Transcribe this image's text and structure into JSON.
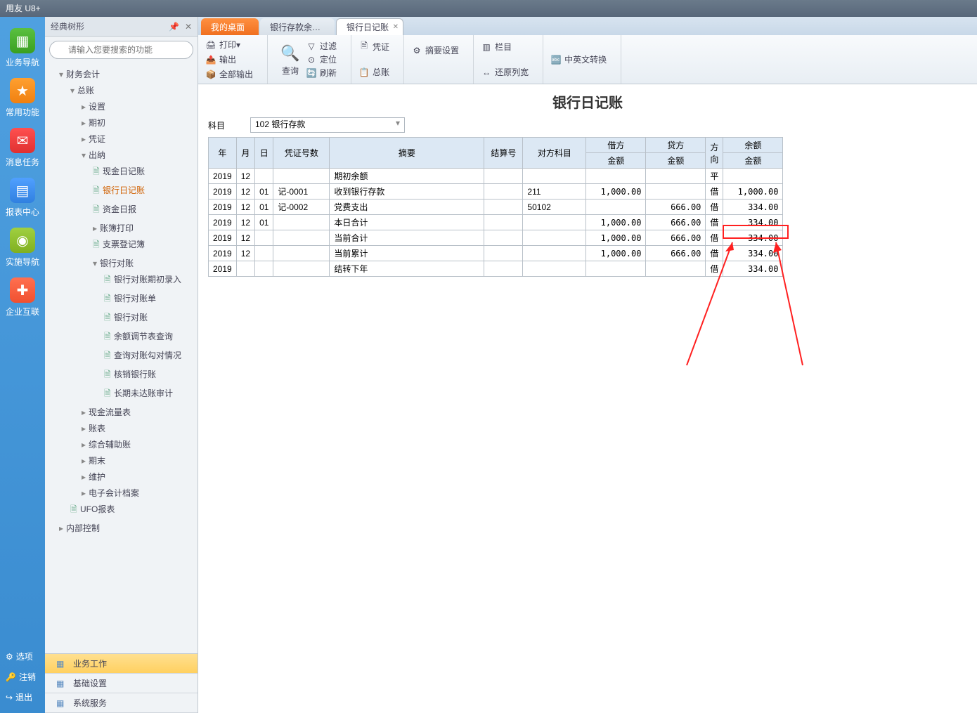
{
  "app_title": "用友 U8+",
  "leftbar": [
    {
      "label": "业务导航",
      "cls": "ic-green",
      "glyph": "▦"
    },
    {
      "label": "常用功能",
      "cls": "ic-orange",
      "glyph": "★"
    },
    {
      "label": "消息任务",
      "cls": "ic-red",
      "glyph": "✉"
    },
    {
      "label": "报表中心",
      "cls": "ic-blue",
      "glyph": "▤"
    },
    {
      "label": "实施导航",
      "cls": "ic-lime",
      "glyph": "◉"
    },
    {
      "label": "企业互联",
      "cls": "ic-multi",
      "glyph": "✚"
    }
  ],
  "leftbar_bottom": [
    {
      "icon": "⚙",
      "label": "选项"
    },
    {
      "icon": "🔑",
      "label": "注销"
    },
    {
      "icon": "↪",
      "label": "退出"
    }
  ],
  "sidebar_title": "经典树形",
  "search_placeholder": "请输入您要搜索的功能",
  "tree": [
    {
      "d": 1,
      "caret": "▾",
      "label": "财务会计"
    },
    {
      "d": 2,
      "caret": "▾",
      "label": "总账"
    },
    {
      "d": 3,
      "caret": "▸",
      "label": "设置"
    },
    {
      "d": 3,
      "caret": "▸",
      "label": "期初"
    },
    {
      "d": 3,
      "caret": "▸",
      "label": "凭证"
    },
    {
      "d": 3,
      "caret": "▾",
      "label": "出纳"
    },
    {
      "d": 4,
      "doc": true,
      "label": "现金日记账"
    },
    {
      "d": 4,
      "doc": true,
      "label": "银行日记账",
      "active": true
    },
    {
      "d": 4,
      "doc": true,
      "label": "资金日报"
    },
    {
      "d": 4,
      "caret": "▸",
      "label": "账簿打印"
    },
    {
      "d": 4,
      "doc": true,
      "label": "支票登记簿"
    },
    {
      "d": 4,
      "caret": "▾",
      "label": "银行对账"
    },
    {
      "d": 5,
      "doc": true,
      "label": "银行对账期初录入"
    },
    {
      "d": 5,
      "doc": true,
      "label": "银行对账单"
    },
    {
      "d": 5,
      "doc": true,
      "label": "银行对账"
    },
    {
      "d": 5,
      "doc": true,
      "label": "余额调节表查询"
    },
    {
      "d": 5,
      "doc": true,
      "label": "查询对账勾对情况"
    },
    {
      "d": 5,
      "doc": true,
      "label": "核销银行账"
    },
    {
      "d": 5,
      "doc": true,
      "label": "长期未达账审计"
    },
    {
      "d": 3,
      "caret": "▸",
      "label": "现金流量表"
    },
    {
      "d": 3,
      "caret": "▸",
      "label": "账表"
    },
    {
      "d": 3,
      "caret": "▸",
      "label": "综合辅助账"
    },
    {
      "d": 3,
      "caret": "▸",
      "label": "期末"
    },
    {
      "d": 3,
      "caret": "▸",
      "label": "维护"
    },
    {
      "d": 3,
      "caret": "▸",
      "label": "电子会计档案"
    },
    {
      "d": 2,
      "doc": true,
      "label": "UFO报表"
    },
    {
      "d": 1,
      "caret": "▸",
      "label": "内部控制"
    }
  ],
  "sidebar_tabs": [
    {
      "label": "业务工作",
      "active": true
    },
    {
      "label": "基础设置"
    },
    {
      "label": "系统服务"
    }
  ],
  "tabs": [
    {
      "label": "我的桌面",
      "type": "orange"
    },
    {
      "label": "银行存款余…",
      "type": "inactive"
    },
    {
      "label": "银行日记账",
      "type": "active",
      "closable": true
    }
  ],
  "toolbar": {
    "print": "打印",
    "export": "输出",
    "export_all": "全部输出",
    "query": "查询",
    "filter": "过滤",
    "locate": "定位",
    "refresh": "刷新",
    "voucher": "凭证",
    "summary": "总账",
    "summary_set": "摘要设置",
    "column": "栏目",
    "restore": "还原列宽",
    "translate": "中英文转换"
  },
  "page_title": "银行日记账",
  "subject_label": "科目",
  "subject_value": "102 银行存款",
  "headers": {
    "year": "年",
    "month": "月",
    "day": "日",
    "voucher": "凭证号数",
    "summary": "摘要",
    "settle": "结算号",
    "counter": "对方科目",
    "debit": "借方",
    "credit": "贷方",
    "dir": "方向",
    "balance": "余额",
    "amount": "金额"
  },
  "rows": [
    {
      "y": "2019",
      "m": "12",
      "d": "",
      "vno": "",
      "sum": "期初余额",
      "set": "",
      "ctr": "",
      "deb": "",
      "cre": "",
      "dir": "平",
      "bal": ""
    },
    {
      "y": "2019",
      "m": "12",
      "d": "01",
      "vno": "记-0001",
      "sum": "收到银行存款",
      "set": "",
      "ctr": "211",
      "deb": "1,000.00",
      "cre": "",
      "dir": "借",
      "bal": "1,000.00"
    },
    {
      "y": "2019",
      "m": "12",
      "d": "01",
      "vno": "记-0002",
      "sum": "党费支出",
      "set": "",
      "ctr": "50102",
      "deb": "",
      "cre": "666.00",
      "dir": "借",
      "bal": "334.00"
    },
    {
      "y": "2019",
      "m": "12",
      "d": "01",
      "vno": "",
      "sum": "本日合计",
      "set": "",
      "ctr": "",
      "deb": "1,000.00",
      "cre": "666.00",
      "dir": "借",
      "bal": "334.00"
    },
    {
      "y": "2019",
      "m": "12",
      "d": "",
      "vno": "",
      "sum": "当前合计",
      "set": "",
      "ctr": "",
      "deb": "1,000.00",
      "cre": "666.00",
      "dir": "借",
      "bal": "334.00"
    },
    {
      "y": "2019",
      "m": "12",
      "d": "",
      "vno": "",
      "sum": "当前累计",
      "set": "",
      "ctr": "",
      "deb": "1,000.00",
      "cre": "666.00",
      "dir": "借",
      "bal": "334.00"
    },
    {
      "y": "2019",
      "m": "",
      "d": "",
      "vno": "",
      "sum": "结转下年",
      "set": "",
      "ctr": "",
      "deb": "",
      "cre": "",
      "dir": "借",
      "bal": "334.00"
    }
  ]
}
